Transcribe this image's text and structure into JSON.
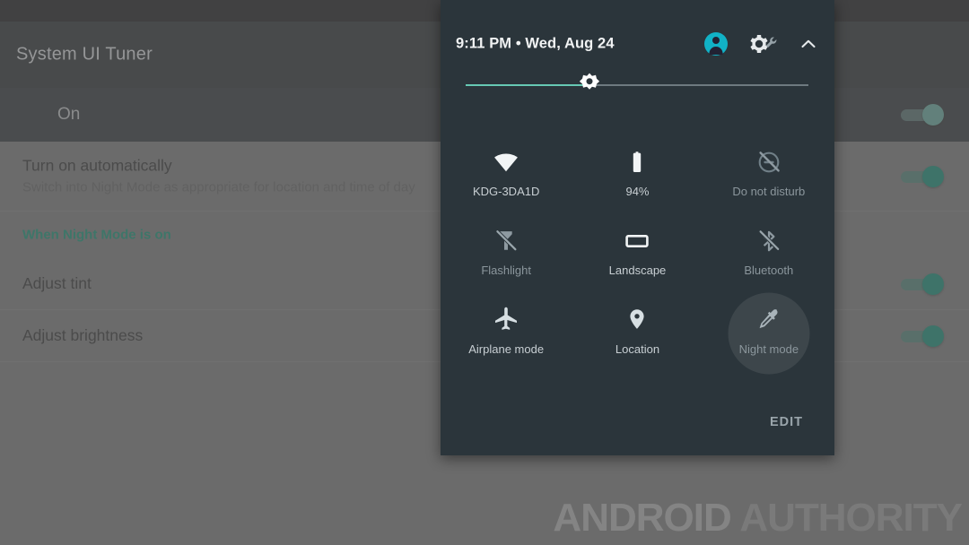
{
  "app": {
    "title": "System UI Tuner",
    "status_row_label": "On",
    "status_row_switch": "on",
    "preferences": [
      {
        "title": "Turn on automatically",
        "summary": "Switch into Night Mode as appropriate for location and time of day",
        "switch": "on"
      }
    ],
    "section_header": "When Night Mode is on",
    "preferences_section": [
      {
        "title": "Adjust tint",
        "switch": "on"
      },
      {
        "title": "Adjust brightness",
        "switch": "on"
      }
    ]
  },
  "quick_settings": {
    "time": "9:11 PM",
    "separator": "•",
    "date": "Wed, Aug 24",
    "datetime": "9:11 PM  •  Wed, Aug 24",
    "header_icons": [
      {
        "name": "avatar-icon",
        "label": "User avatar"
      },
      {
        "name": "system-ui-tuner-icon",
        "label": "System UI Tuner"
      },
      {
        "name": "chevron-up-icon",
        "label": "Collapse"
      }
    ],
    "brightness": {
      "name": "brightness-slider",
      "percent": 36,
      "fill_color": "#66c9b4",
      "track_color": "#6e7a80"
    },
    "tiles": [
      {
        "label": "KDG-3DA1D",
        "icon": "wifi-icon",
        "state": "on"
      },
      {
        "label": "94%",
        "icon": "battery-icon",
        "state": "on"
      },
      {
        "label": "Do not disturb",
        "icon": "do-not-disturb-off-icon",
        "state": "off"
      },
      {
        "label": "Flashlight",
        "icon": "flashlight-off-icon",
        "state": "off"
      },
      {
        "label": "Landscape",
        "icon": "rotation-landscape-icon",
        "state": "on"
      },
      {
        "label": "Bluetooth",
        "icon": "bluetooth-off-icon",
        "state": "off"
      },
      {
        "label": "Airplane mode",
        "icon": "airplane-icon",
        "state": "on"
      },
      {
        "label": "Location",
        "icon": "location-pin-icon",
        "state": "on"
      },
      {
        "label": "Night mode",
        "icon": "night-mode-eyedropper-icon",
        "state": "pressed"
      }
    ],
    "edit_label": "EDIT",
    "panel_color": "#2b353b"
  },
  "watermark": {
    "word1": "ANDROID",
    "word2": "AUTHORITY"
  }
}
